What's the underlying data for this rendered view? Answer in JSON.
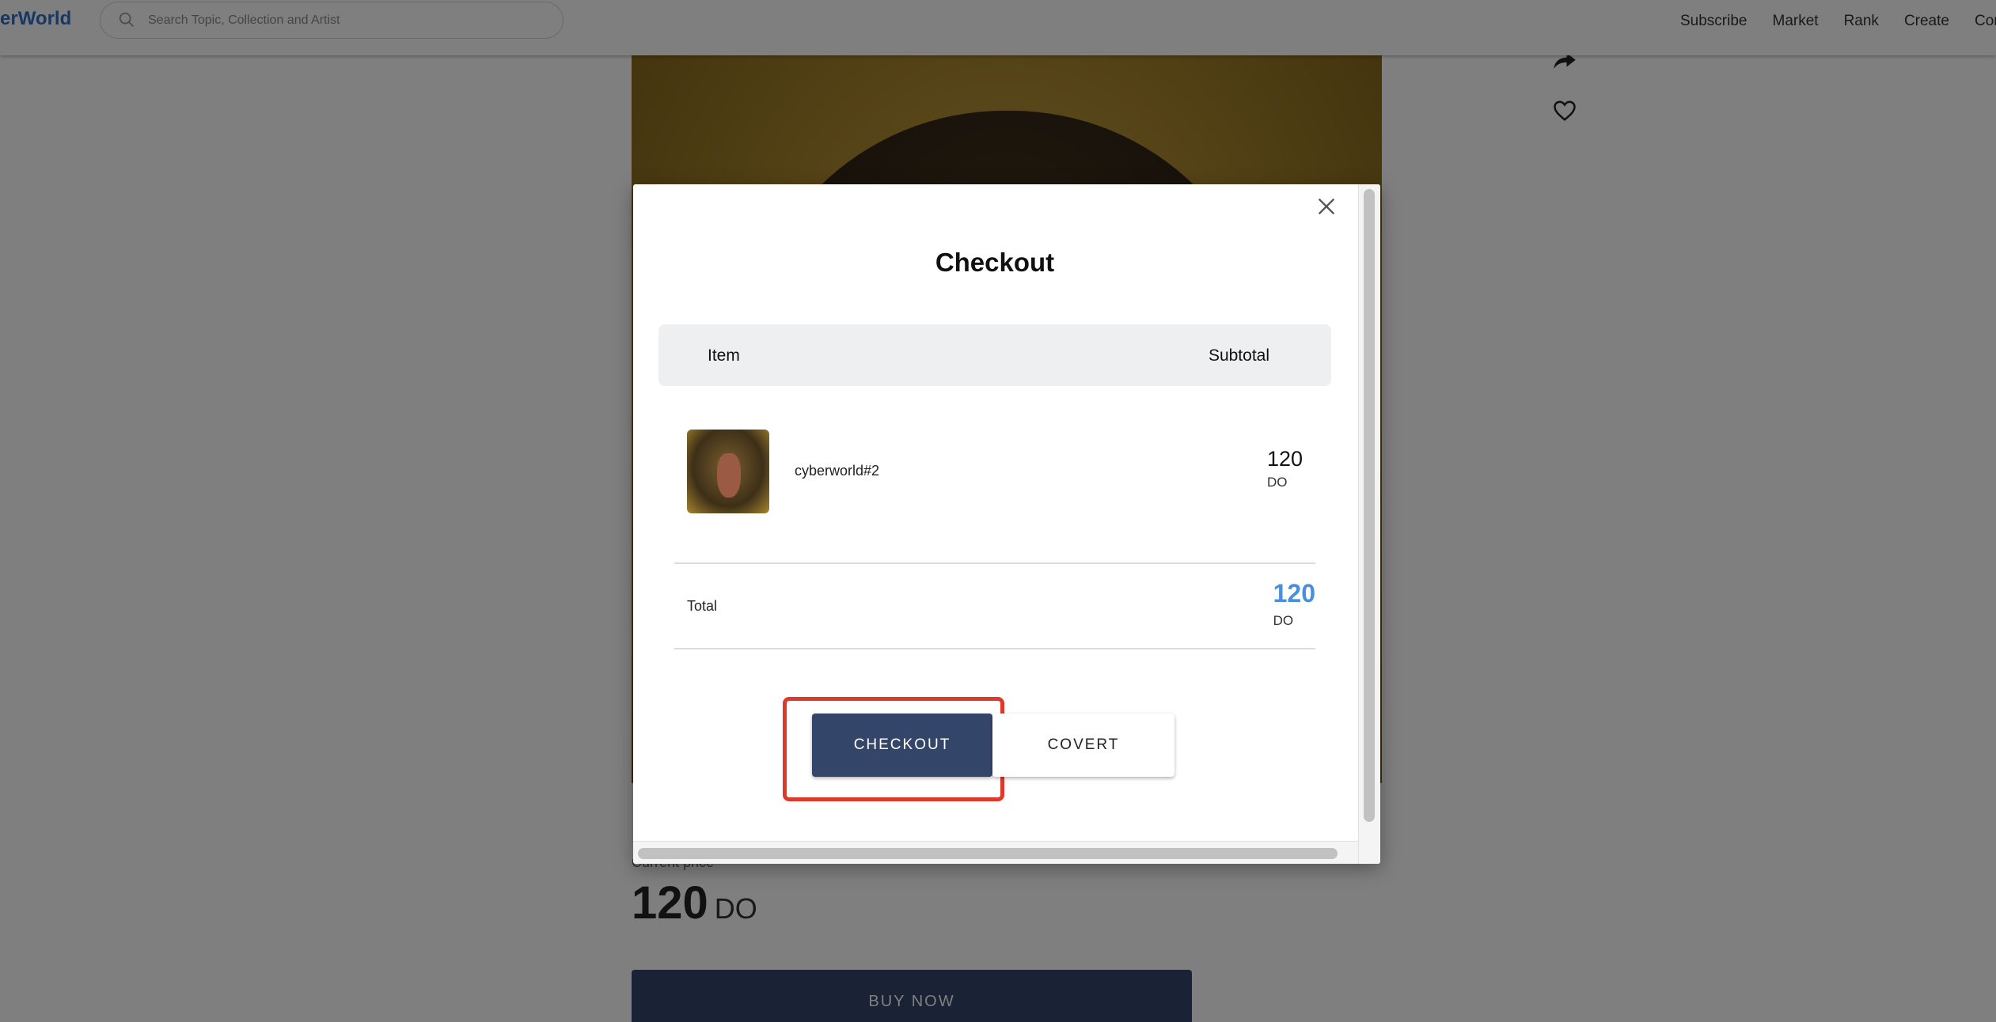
{
  "header": {
    "logo": "erWorld",
    "search_placeholder": "Search Topic, Collection and Artist",
    "nav": [
      "Subscribe",
      "Market",
      "Rank",
      "Create",
      "Com"
    ]
  },
  "product": {
    "current_price_label": "Current price",
    "price_value": "120",
    "price_unit": "DO",
    "buy_now_label": "BUY NOW"
  },
  "modal": {
    "title": "Checkout",
    "columns": {
      "item": "Item",
      "subtotal": "Subtotal"
    },
    "item": {
      "name": "cyberworld#2",
      "price": "120",
      "unit": "DO"
    },
    "total": {
      "label": "Total",
      "value": "120",
      "unit": "DO",
      "value_color": "#4a8fd9"
    },
    "buttons": {
      "checkout": "CHECKOUT",
      "covert": "COVERT"
    }
  },
  "colors": {
    "primary_button": "#34456a",
    "highlight": "#e0392b",
    "brand": "#2f6fc9"
  }
}
